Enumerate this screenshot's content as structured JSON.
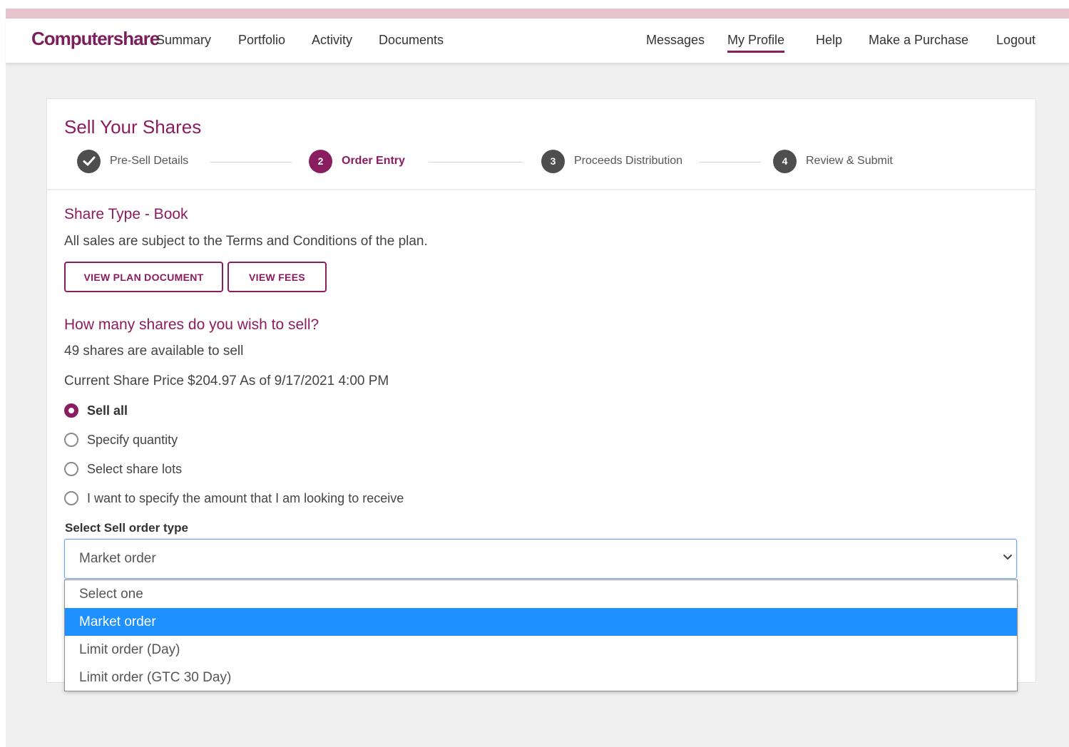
{
  "nav": {
    "logo": "Computershare",
    "links": [
      "Summary",
      "Portfolio",
      "Activity",
      "Documents"
    ],
    "right_links": [
      "Messages",
      "My Profile",
      "Help",
      "Make a Purchase",
      "Logout"
    ],
    "active": "My Profile"
  },
  "page": {
    "title": "Sell Your Shares",
    "steps": [
      {
        "number": "",
        "label": "Pre-Sell Details",
        "state": "complete"
      },
      {
        "number": "2",
        "label": "Order Entry",
        "state": "current"
      },
      {
        "number": "3",
        "label": "Proceeds Distribution",
        "state": "upcoming"
      },
      {
        "number": "4",
        "label": "Review & Submit",
        "state": "upcoming"
      }
    ]
  },
  "share_type": {
    "title": "Share Type - Book",
    "terms": "All sales are subject to the Terms and Conditions of the plan.",
    "view_plan_label": "VIEW PLAN DOCUMENT",
    "view_fees_label": "VIEW FEES"
  },
  "quantity": {
    "question": "How many shares do you wish to sell?",
    "available": "49 shares are available to sell",
    "price": "Current Share Price $204.97 As of 9/17/2021 4:00 PM",
    "options": [
      {
        "label": "Sell all",
        "checked": true
      },
      {
        "label": "Specify quantity",
        "checked": false
      },
      {
        "label": "Select share lots",
        "checked": false
      },
      {
        "label": "I want to specify the amount that I am looking to receive",
        "checked": false
      }
    ]
  },
  "order_type": {
    "label": "Select Sell order type",
    "value": "Market order",
    "options": [
      "Select one",
      "Market order",
      "Limit order (Day)",
      "Limit order (GTC 30 Day)"
    ],
    "highlighted_index": 1
  },
  "colors": {
    "brand": "#8a1c60",
    "highlight": "#1e90ff",
    "top_strip": "#e7c3cd"
  }
}
